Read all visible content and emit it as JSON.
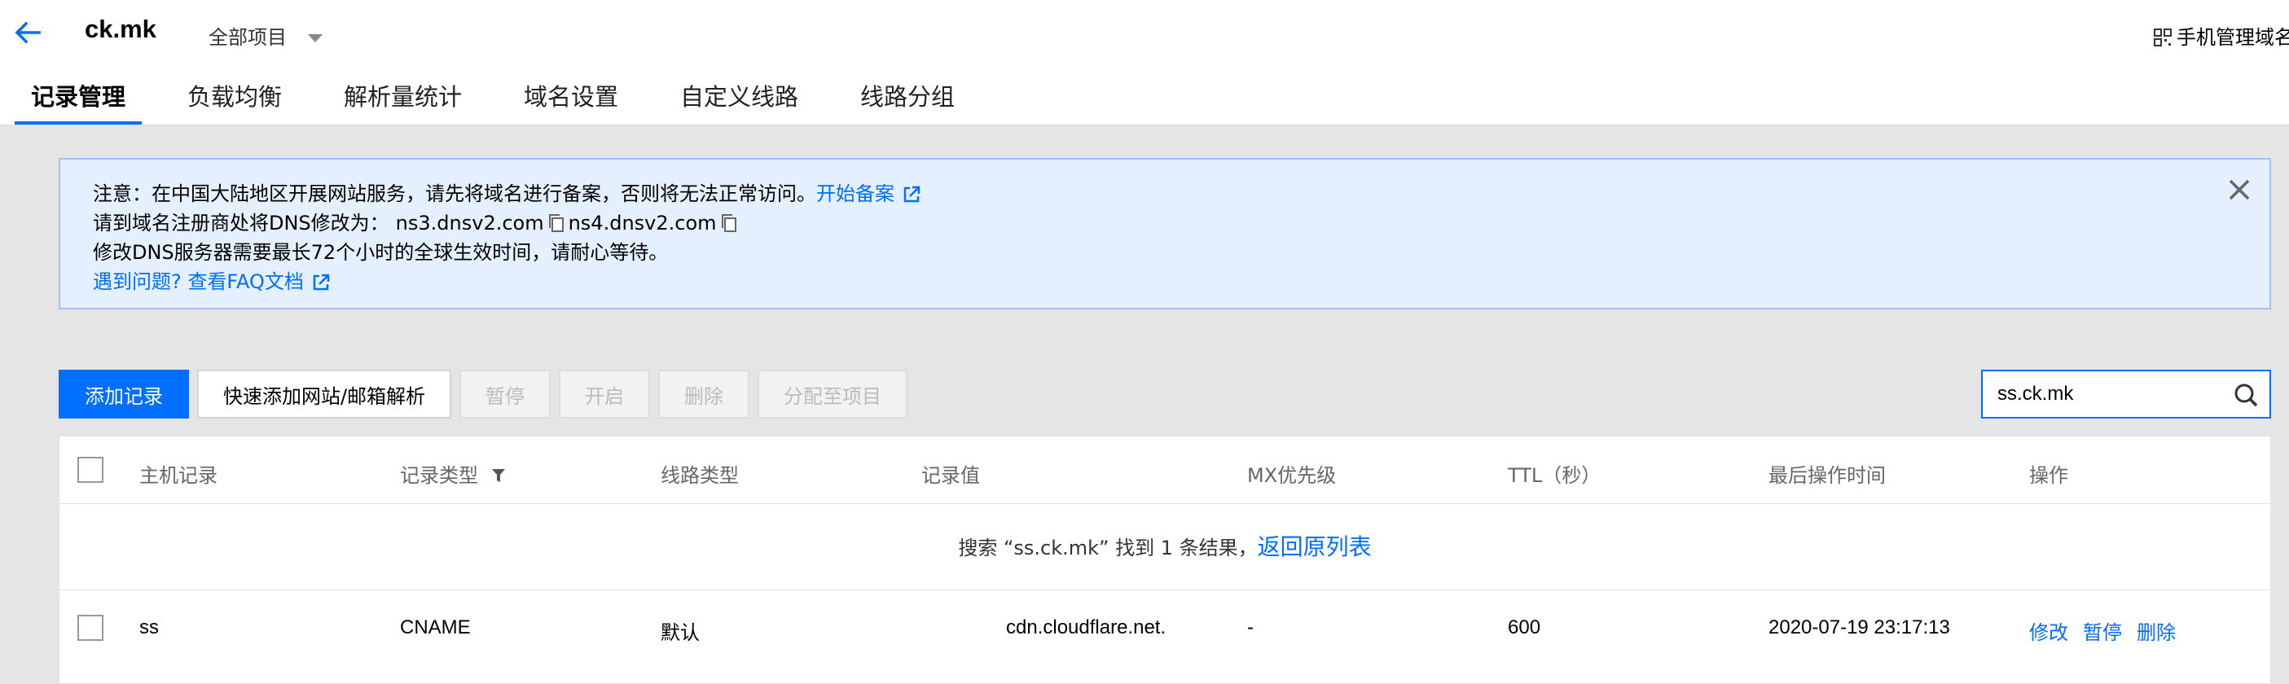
{
  "header": {
    "domain": "ck.mk",
    "project": "全部项目",
    "mobile_manage": "手机管理域名"
  },
  "tabs": [
    {
      "label": "记录管理",
      "active": true
    },
    {
      "label": "负载均衡"
    },
    {
      "label": "解析量统计"
    },
    {
      "label": "域名设置"
    },
    {
      "label": "自定义线路"
    },
    {
      "label": "线路分组"
    }
  ],
  "notice": {
    "line1_text": "注意：在中国大陆地区开展网站服务，请先将域名进行备案，否则将无法正常访问。",
    "line1_link": "开始备案",
    "line2_text": "请到域名注册商处将DNS修改为：",
    "ns1": "ns3.dnsv2.com",
    "ns2": "ns4.dnsv2.com",
    "line3_text": "修改DNS服务器需要最长72个小时的全球生效时间，请耐心等待。",
    "line4_text": "遇到问题? 查看FAQ文档"
  },
  "toolbar": {
    "add_record": "添加记录",
    "quick_add": "快速添加网站/邮箱解析",
    "pause": "暂停",
    "enable": "开启",
    "delete": "删除",
    "assign_project": "分配至项目"
  },
  "search": {
    "value": "ss.ck.mk"
  },
  "table": {
    "headers": {
      "host": "主机记录",
      "type": "记录类型",
      "line": "线路类型",
      "value": "记录值",
      "mx": "MX优先级",
      "ttl": "TTL（秒）",
      "last_modified": "最后操作时间",
      "actions": "操作"
    },
    "search_result_text": "搜索 “ss.ck.mk” 找到 1 条结果，",
    "search_result_link": "返回原列表",
    "rows": [
      {
        "host": "ss",
        "type": "CNAME",
        "line": "默认",
        "value": "cdn.cloudflare.net.",
        "mx": "-",
        "ttl": "600",
        "last_modified": "2020-07-19 23:17:13",
        "action_edit": "修改",
        "action_pause": "暂停",
        "action_delete": "删除"
      }
    ]
  },
  "colors": {
    "primary": "#006eff",
    "notice_bg": "#e5f0ff",
    "page_bg": "#e5e5e5"
  }
}
